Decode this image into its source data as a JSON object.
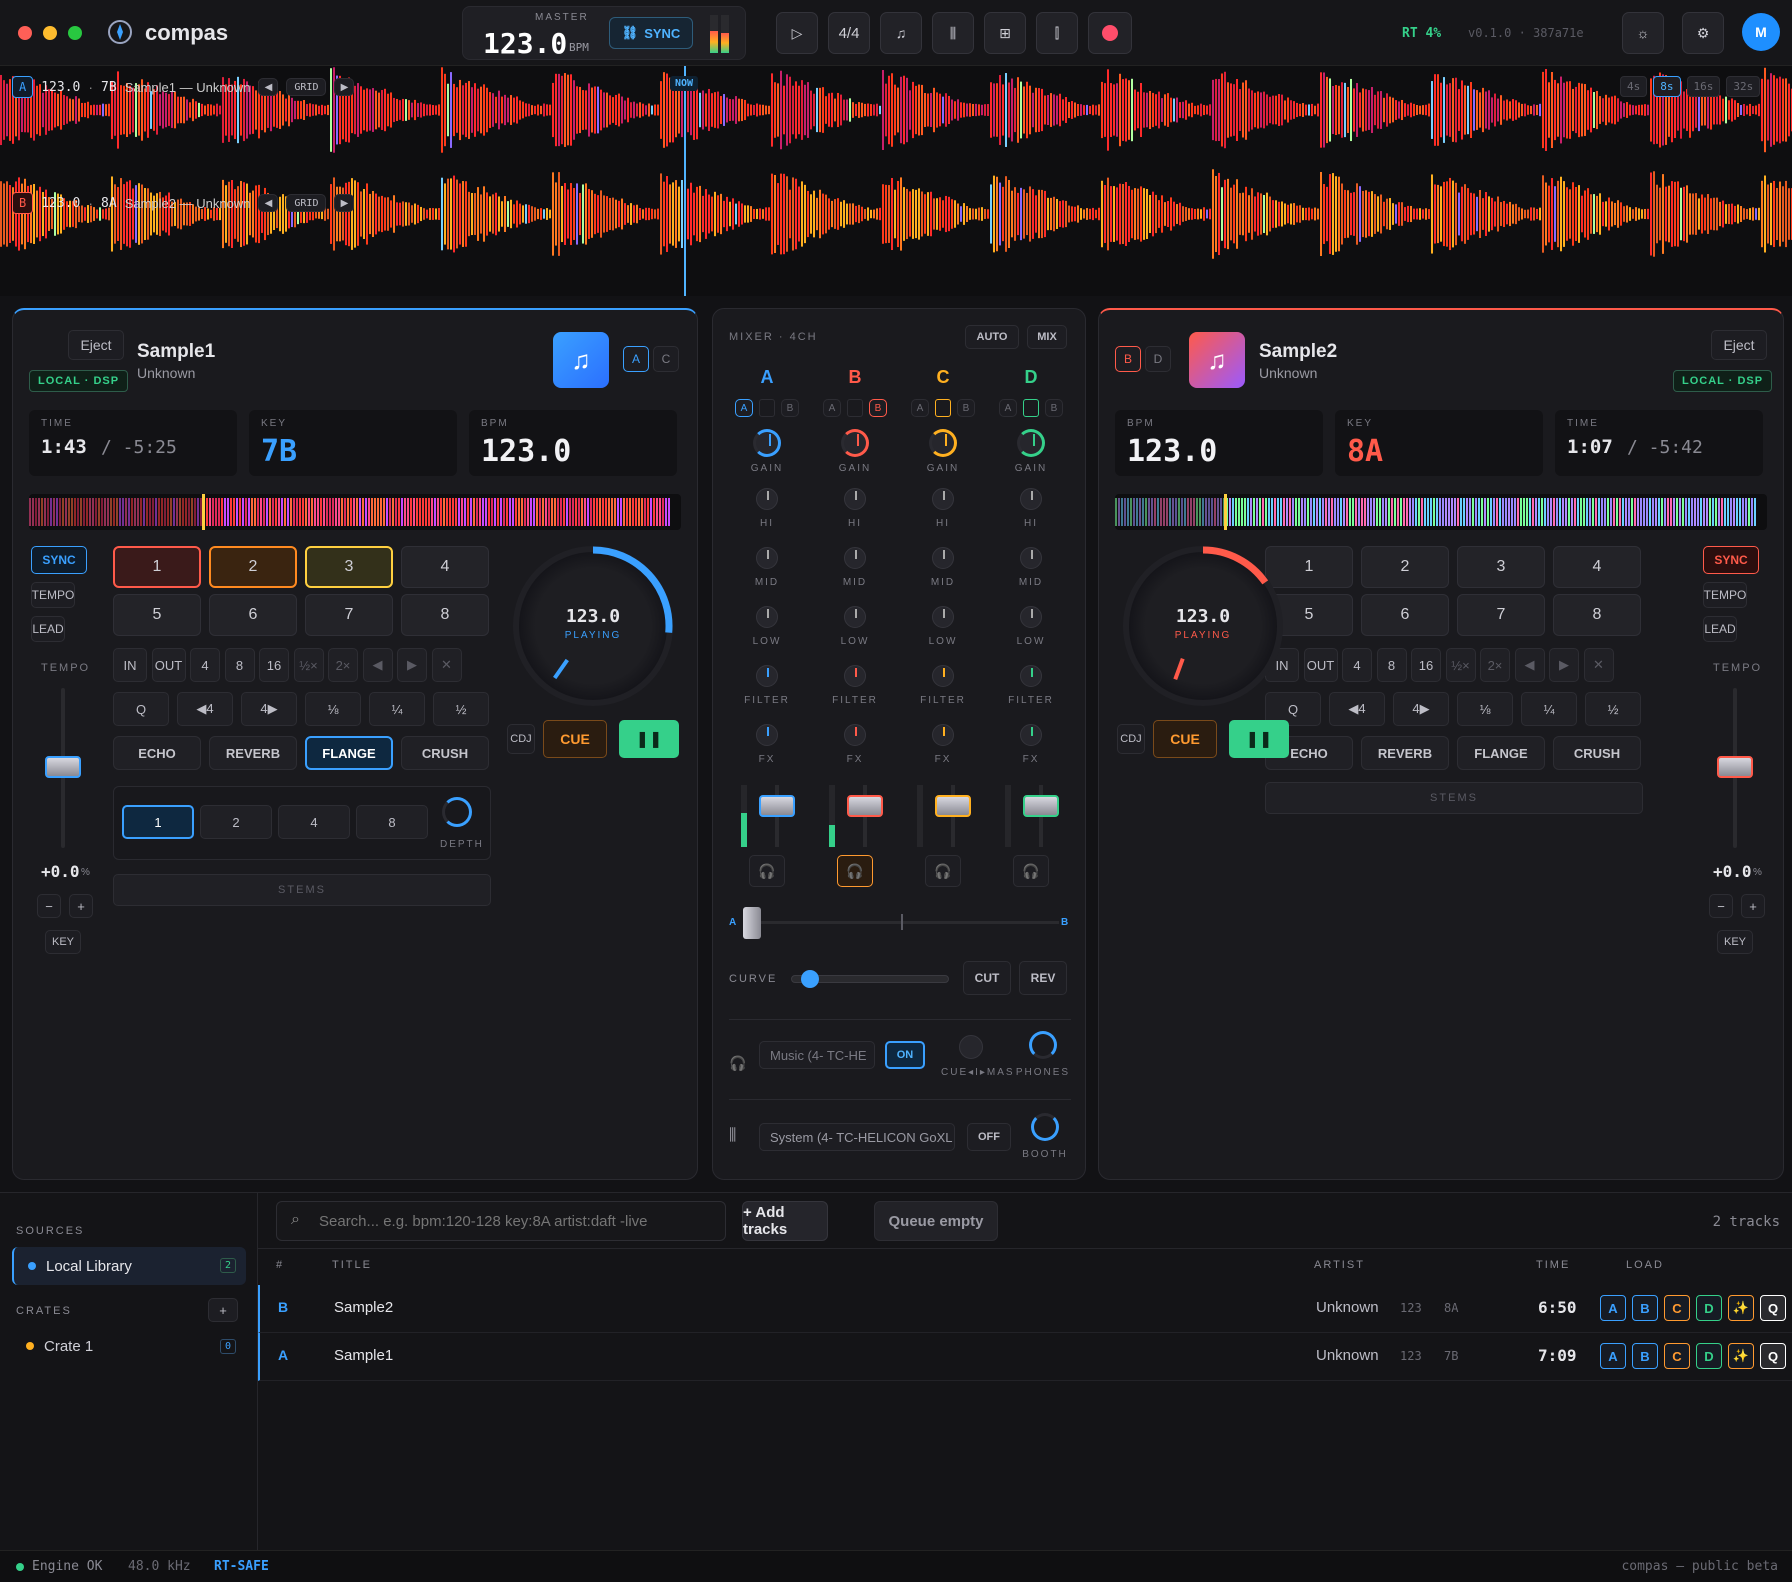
{
  "app": {
    "name": "compas"
  },
  "topbar": {
    "master_label": "MASTER",
    "master_bpm": "123.0",
    "bpm_unit": "BPM",
    "sync": "SYNC",
    "meter": "4/4",
    "rt": "RT 4%",
    "version": "v0.1.0 · 387a71e",
    "avatar": "M"
  },
  "waveform": {
    "a": {
      "deck": "A",
      "bpm": "123.0",
      "key": "7B",
      "track": "Sample1 — Unknown",
      "grid": "GRID"
    },
    "b": {
      "deck": "B",
      "bpm": "123.0",
      "key": "8A",
      "track": "Sample2 — Unknown",
      "grid": "GRID"
    },
    "now": "NOW",
    "zoom": [
      "4s",
      "8s",
      "16s",
      "32s"
    ],
    "zoom_selected": "8s"
  },
  "deck_a": {
    "eject": "Eject",
    "title": "Sample1",
    "artist": "Unknown",
    "source": "LOCAL · DSP",
    "assign": [
      "A",
      "C"
    ],
    "time_label": "TIME",
    "time": "1:43",
    "remaining": "/ -5:25",
    "key_label": "KEY",
    "key": "7B",
    "bpm_label": "BPM",
    "bpm": "123.0",
    "sync": "SYNC",
    "tempo": "TEMPO",
    "lead": "LEAD",
    "tempo_label": "TEMPO",
    "pitch": "+0.0",
    "pitch_unit": "%",
    "minus": "−",
    "plus": "+",
    "key_btn": "KEY",
    "pads": [
      "1",
      "2",
      "3",
      "4",
      "5",
      "6",
      "7",
      "8"
    ],
    "loop": [
      "IN",
      "OUT",
      "4",
      "8",
      "16",
      "½×",
      "2×",
      "◀",
      "▶",
      "✕"
    ],
    "beat": [
      "Q",
      "◀4",
      "4▶",
      "⅛",
      "¼",
      "½"
    ],
    "fx": [
      "ECHO",
      "REVERB",
      "FLANGE",
      "CRUSH"
    ],
    "fx_active": "FLANGE",
    "depth_beats": [
      "1",
      "2",
      "4",
      "8"
    ],
    "depth": "DEPTH",
    "stems": "STEMS",
    "jog_bpm": "123.0",
    "jog_state": "PLAYING",
    "cdj": "CDJ",
    "cue": "CUE",
    "progress": 0.27
  },
  "deck_b": {
    "eject": "Eject",
    "title": "Sample2",
    "artist": "Unknown",
    "source": "LOCAL · DSP",
    "assign": [
      "B",
      "D"
    ],
    "time_label": "TIME",
    "time": "1:07",
    "remaining": "/ -5:42",
    "key_label": "KEY",
    "key": "8A",
    "bpm_label": "BPM",
    "bpm": "123.0",
    "sync": "SYNC",
    "tempo": "TEMPO",
    "lead": "LEAD",
    "tempo_label": "TEMPO",
    "pitch": "+0.0",
    "pitch_unit": "%",
    "minus": "−",
    "plus": "+",
    "key_btn": "KEY",
    "pads": [
      "1",
      "2",
      "3",
      "4",
      "5",
      "6",
      "7",
      "8"
    ],
    "loop": [
      "IN",
      "OUT",
      "4",
      "8",
      "16",
      "½×",
      "2×",
      "◀",
      "▶",
      "✕"
    ],
    "beat": [
      "Q",
      "◀4",
      "4▶",
      "⅛",
      "¼",
      "½"
    ],
    "fx": [
      "ECHO",
      "REVERB",
      "FLANGE",
      "CRUSH"
    ],
    "stems": "STEMS",
    "jog_bpm": "123.0",
    "jog_state": "PLAYING",
    "cdj": "CDJ",
    "cue": "CUE",
    "progress": 0.17
  },
  "mixer": {
    "title": "MIXER · 4CH",
    "auto": "AUTO",
    "mix": "MIX",
    "channels": [
      {
        "name": "A",
        "color": "#3aa0ff",
        "assign": [
          "A",
          "B"
        ]
      },
      {
        "name": "B",
        "color": "#ff5a4a",
        "assign": [
          "A",
          "B"
        ]
      },
      {
        "name": "C",
        "color": "#ffb020",
        "assign": [
          "A",
          "B"
        ]
      },
      {
        "name": "D",
        "color": "#35d08a",
        "assign": [
          "A",
          "B"
        ]
      }
    ],
    "knobs": [
      "GAIN",
      "HI",
      "MID",
      "LOW",
      "FILTER",
      "FX"
    ],
    "xf_a": "A",
    "xf_b": "B",
    "curve": "CURVE",
    "cut": "CUT",
    "rev": "REV",
    "cue_device": "Music (4- TC-HE",
    "on": "ON",
    "cue_mix": "CUE◂I▸MAS",
    "phones": "PHONES",
    "booth_device": "System (4- TC-HELICON GoXL",
    "off": "OFF",
    "booth": "BOOTH"
  },
  "library": {
    "sources": "SOURCES",
    "local": "Local Library",
    "local_count": "2",
    "crates": "CRATES",
    "add": "+",
    "crate1": "Crate 1",
    "crate_count": "0",
    "search_placeholder": "Search... e.g. bpm:120-128 key:8A artist:daft -live",
    "add_tracks": "+ Add tracks",
    "queue": "Queue empty",
    "count": "2 tracks",
    "cols": {
      "num": "#",
      "title": "TITLE",
      "artist": "ARTIST",
      "time": "TIME",
      "load": "LOAD"
    },
    "rows": [
      {
        "deck": "B",
        "title": "Sample2",
        "artist": "Unknown",
        "bpm": "123",
        "key": "8A",
        "time": "6:50"
      },
      {
        "deck": "A",
        "title": "Sample1",
        "artist": "Unknown",
        "bpm": "123",
        "key": "7B",
        "time": "7:09"
      }
    ],
    "load_btns": [
      "A",
      "B",
      "C",
      "D",
      "✨",
      "Q"
    ]
  },
  "status": {
    "engine": "Engine OK",
    "rate": "48.0 kHz",
    "rt": "RT-SAFE",
    "footer": "compas — public beta"
  }
}
